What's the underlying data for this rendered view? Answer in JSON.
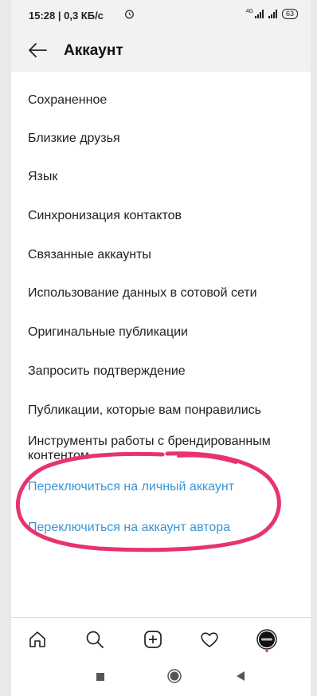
{
  "status_bar": {
    "time": "15:28 | 0,3 КБ/с",
    "battery": "63",
    "network": "4G"
  },
  "header": {
    "title": "Аккаунт",
    "back_icon": "arrow-left-icon"
  },
  "menu": {
    "items": [
      {
        "label": "Сохраненное"
      },
      {
        "label": "Близкие друзья"
      },
      {
        "label": "Язык"
      },
      {
        "label": "Синхронизация контактов"
      },
      {
        "label": "Связанные аккаунты"
      },
      {
        "label": "Использование данных в сотовой сети"
      },
      {
        "label": "Оригинальные публикации"
      },
      {
        "label": "Запросить подтверждение"
      },
      {
        "label": "Публикации, которые вам понравились"
      },
      {
        "label": "Инструменты работы с брендированным контентом"
      }
    ],
    "links": [
      {
        "label": "Переключиться на личный аккаунт"
      },
      {
        "label": "Переключиться на аккаунт автора"
      }
    ]
  },
  "colors": {
    "link": "#3897d6",
    "annotation": "#e8336f"
  },
  "bottom_nav": {
    "icons": [
      "home-icon",
      "search-icon",
      "add-post-icon",
      "heart-icon",
      "profile-avatar"
    ]
  },
  "system_nav": {
    "icons": [
      "recent-apps-icon",
      "home-circle-icon",
      "back-triangle-icon"
    ]
  }
}
